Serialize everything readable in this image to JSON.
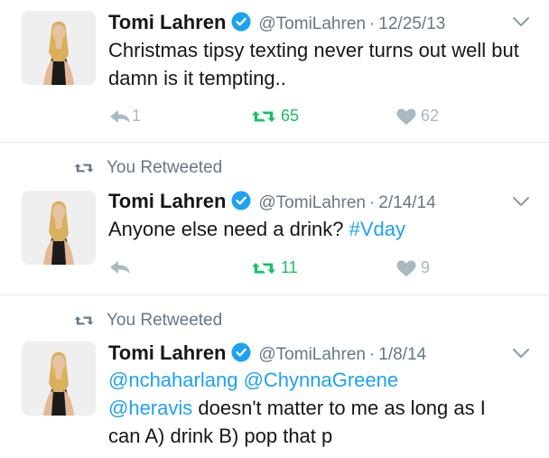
{
  "tweets": [
    {
      "retweeted_by_you": false,
      "name": "Tomi Lahren",
      "handle": "@TomiLahren",
      "separator": "·",
      "date": "12/25/13",
      "text": "Christmas tipsy texting never turns out well but damn is it tempting..",
      "replies": "1",
      "retweets": "65",
      "likes": "62"
    },
    {
      "retweeted_by_you": true,
      "retweet_label": "You Retweeted",
      "name": "Tomi Lahren",
      "handle": "@TomiLahren",
      "separator": "·",
      "date": "2/14/14",
      "text_plain": "Anyone else need a drink? ",
      "hashtag": "#Vday",
      "replies": "",
      "retweets": "11",
      "likes": "9"
    },
    {
      "retweeted_by_you": true,
      "retweet_label": "You Retweeted",
      "name": "Tomi Lahren",
      "handle": "@TomiLahren",
      "separator": "·",
      "date": "1/8/14",
      "mention1": "@nchaharlang",
      "mention2": "@ChynnaGreene",
      "mention3": "@heravis",
      "text_rest": " doesn't matter to me as long as I can A) drink B) pop that p"
    }
  ],
  "colors": {
    "accent": "#1da1f2",
    "retweet_green": "#17bf63",
    "muted": "#657786",
    "icon_gray": "#aab8c2",
    "divider": "#e6ecf0"
  },
  "icons": [
    "verified-badge-icon",
    "chevron-down-icon",
    "reply-icon",
    "retweet-icon",
    "heart-icon"
  ]
}
